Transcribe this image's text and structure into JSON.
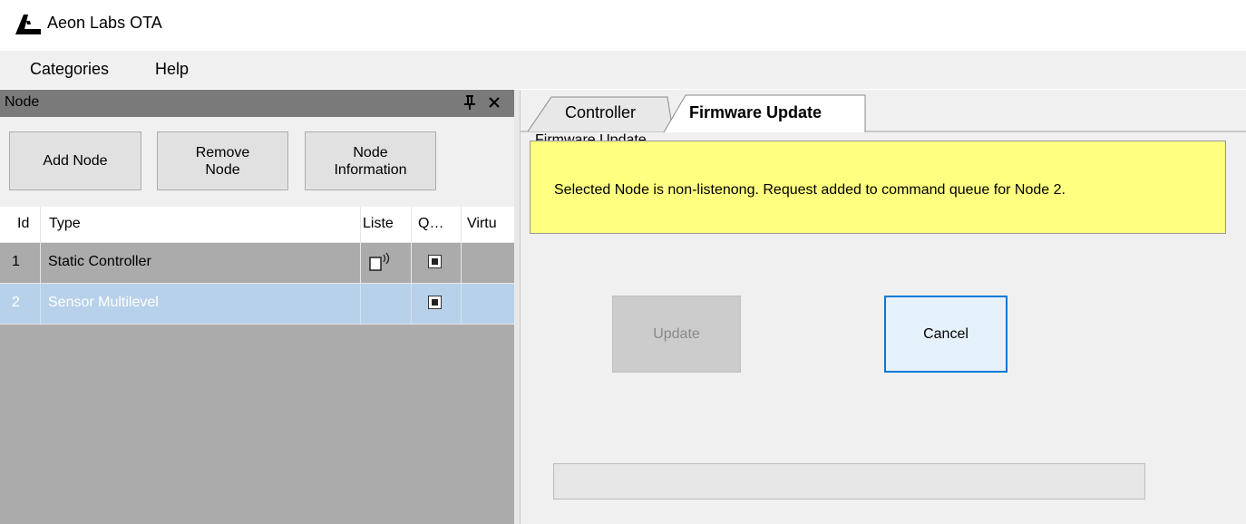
{
  "app": {
    "title": "Aeon Labs OTA",
    "logo_icon": "aeon-logo-icon"
  },
  "menu": {
    "items": [
      "Categories",
      "Help"
    ]
  },
  "node_panel": {
    "title": "Node",
    "pin_icon": "pin-icon",
    "close_icon": "close-icon",
    "buttons": {
      "add_node": "Add Node",
      "remove_node": "Remove\nNode",
      "node_information": "Node\nInformation"
    },
    "table": {
      "columns": [
        "Id",
        "Type",
        "Liste",
        "Q…",
        "Virtu"
      ],
      "rows": [
        {
          "id": "1",
          "type": "Static Controller",
          "listening_icon": "listening-device-icon",
          "queue_checked": true,
          "selected": false
        },
        {
          "id": "2",
          "type": "Sensor Multilevel",
          "listening_icon": "",
          "queue_checked": true,
          "selected": true
        }
      ]
    }
  },
  "tabs": [
    {
      "label": "Controller",
      "active": false
    },
    {
      "label": "Firmware Update",
      "active": true
    }
  ],
  "firmware": {
    "group_label": "Firmware Update",
    "notification": "Selected Node is non-listenong. Request added to command queue for Node 2.",
    "update_label": "Update",
    "cancel_label": "Cancel",
    "progress": 0
  },
  "colors": {
    "notification_bg": "#ffff80",
    "selected_row": "#b8d1ea",
    "focus_border": "#0078d7",
    "panel_header": "#7a7a7a"
  }
}
